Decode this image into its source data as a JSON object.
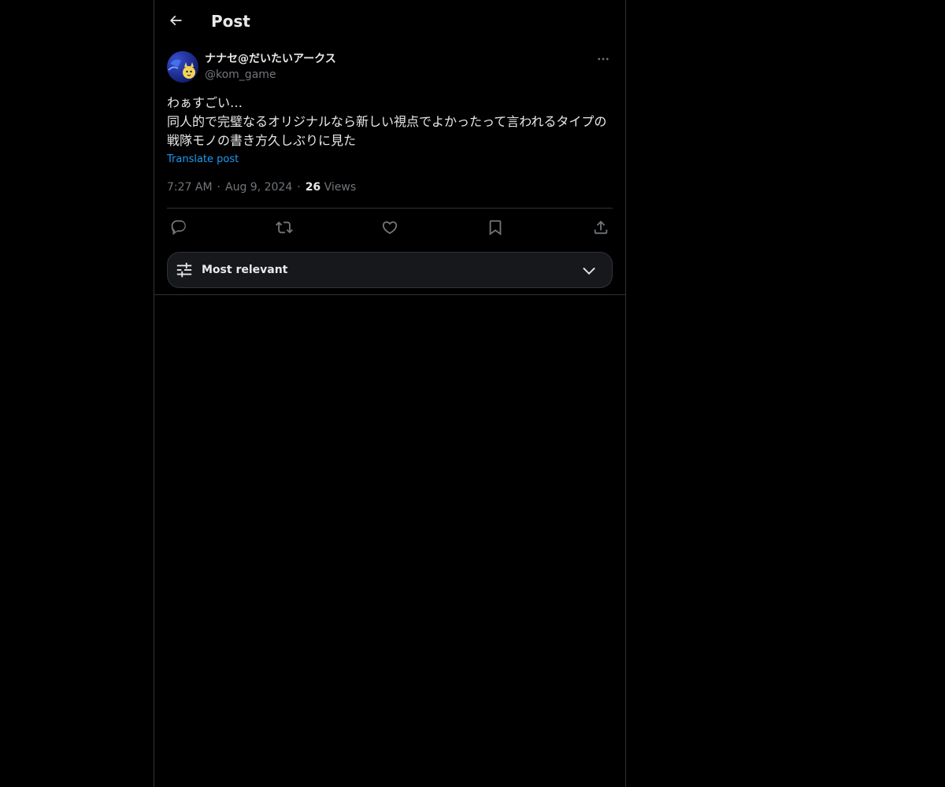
{
  "header": {
    "title": "Post",
    "back_icon": "arrow-left-icon"
  },
  "post": {
    "author_name": "ナナセ@だいたいアークス",
    "author_handle": "@kom_game",
    "more_icon": "more-horizontal-icon",
    "text": "わぁすごい…\n同人的で完璧なるオリジナルなら新しい視点でよかったって言われるタイプの戦隊モノの書き方久しぶりに見た",
    "translate_label": "Translate post",
    "time": "7:27 AM",
    "date": "Aug 9, 2024",
    "views_count": "26",
    "views_label": "Views"
  },
  "actions": {
    "reply_icon": "reply-icon",
    "repost_icon": "repost-icon",
    "like_icon": "heart-icon",
    "bookmark_icon": "bookmark-icon",
    "share_icon": "share-icon"
  },
  "sort": {
    "label": "Most relevant",
    "icon": "sliders-icon",
    "chevron": "chevron-down-icon"
  },
  "colors": {
    "background": "#000000",
    "text": "#e7e9ea",
    "muted": "#71767b",
    "accent": "#1d9bf0",
    "border": "#2f3336"
  }
}
